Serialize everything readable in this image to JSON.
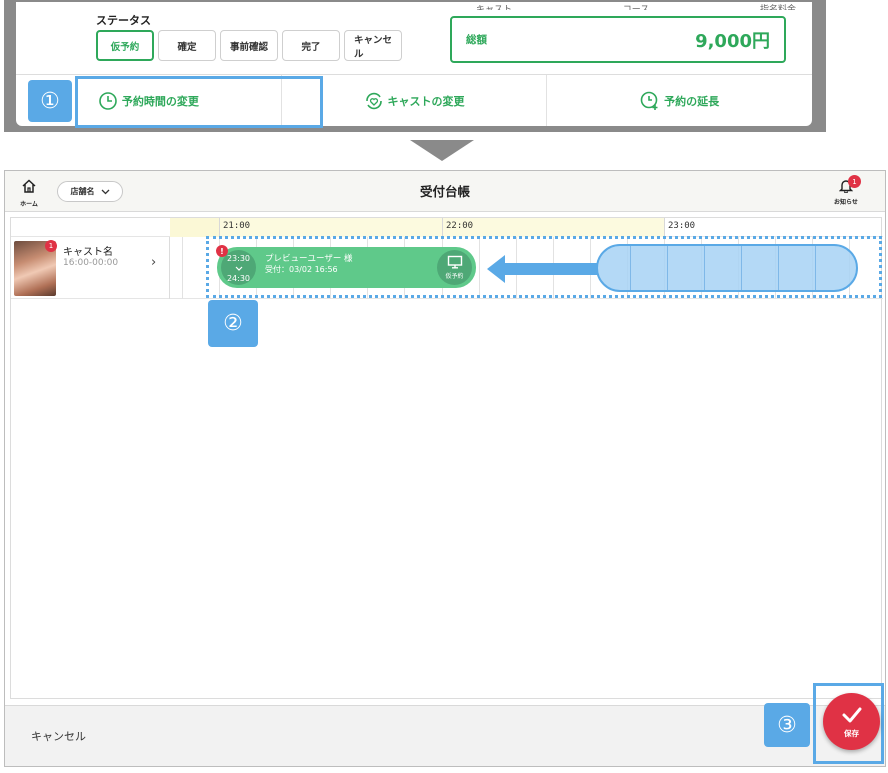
{
  "top_panel": {
    "peek": [
      "キャスト",
      "コース",
      "指名料金"
    ],
    "status_label": "ステータス",
    "status_buttons": [
      "仮予約",
      "確定",
      "事前確認",
      "完了",
      "キャンセル"
    ],
    "total_label": "総額",
    "total_value": "9,000円",
    "actions": [
      "予約時間の変更",
      "キャストの変更",
      "予約の延長"
    ]
  },
  "steps": [
    "①",
    "②",
    "③"
  ],
  "screen": {
    "home_label": "ホーム",
    "store_select": "店舗名",
    "title": "受付台帳",
    "bell_label": "お知らせ",
    "bell_badge": "1",
    "time_labels": [
      "21:00",
      "22:00",
      "23:00"
    ],
    "cast": {
      "badge": "1",
      "name": "キャスト名",
      "hours": "16:00-00:00"
    },
    "reservation": {
      "alert": "!",
      "start": "23:30",
      "end": "24:30",
      "user": "プレビューユーザー 様",
      "received": "受付：03/02 16:56",
      "status": "仮予約"
    },
    "cancel_label": "キャンセル",
    "save_label": "保存"
  },
  "colors": {
    "accent_green": "#2ea85a",
    "highlight_blue": "#5aa9e6",
    "alert_red": "#e03245"
  }
}
